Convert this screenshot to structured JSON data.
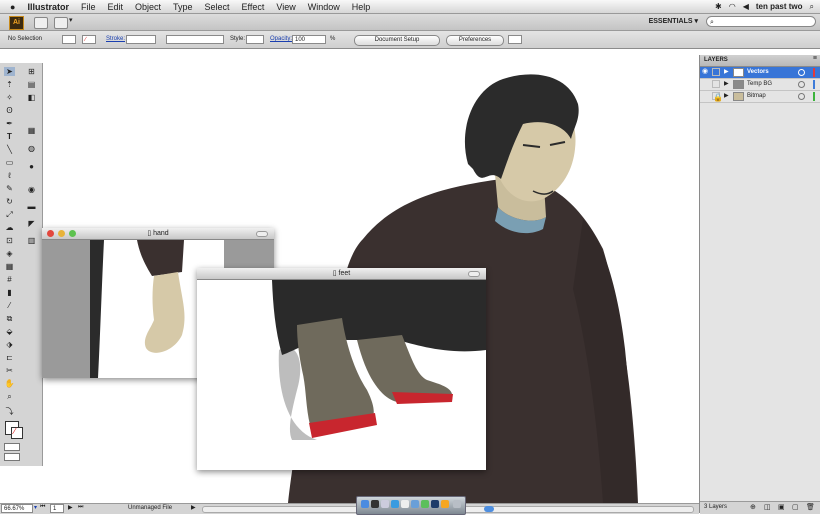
{
  "menubar": {
    "app": "Illustrator",
    "items": [
      "File",
      "Edit",
      "Object",
      "Type",
      "Select",
      "Effect",
      "View",
      "Window",
      "Help"
    ],
    "user": "ten past two"
  },
  "appbar": {
    "logo": "Ai",
    "workspace": "ESSENTIALS ▾"
  },
  "control_bar": {
    "selection": "No Selection",
    "stroke_label": "Stroke:",
    "style_label": "Style:",
    "opacity_label": "Opacity:",
    "opacity_value": "100",
    "opacity_unit": "%",
    "doc_setup": "Document Setup",
    "preferences": "Preferences"
  },
  "layers_panel": {
    "tab": "LAYERS",
    "layers": [
      {
        "name": "Vectors",
        "color": "#e43a3a",
        "selected": true
      },
      {
        "name": "Temp BG",
        "color": "#3d7bd8",
        "selected": false
      },
      {
        "name": "Bitmap",
        "color": "#3bb33b",
        "selected": false
      }
    ],
    "count": "3 Layers"
  },
  "status": {
    "zoom": "66.67%",
    "page": "1",
    "info": "Unmanaged File"
  },
  "windows": {
    "hand": "hand",
    "feet": "feet"
  },
  "colors": {
    "sweater": "#3a302f",
    "skin": "#d6c9a8",
    "hair": "#2b2b2b",
    "collar": "#7a9fb3",
    "boot": "#6f6a5c",
    "sole": "#c8262e",
    "selection_blue": "#3875d7"
  }
}
